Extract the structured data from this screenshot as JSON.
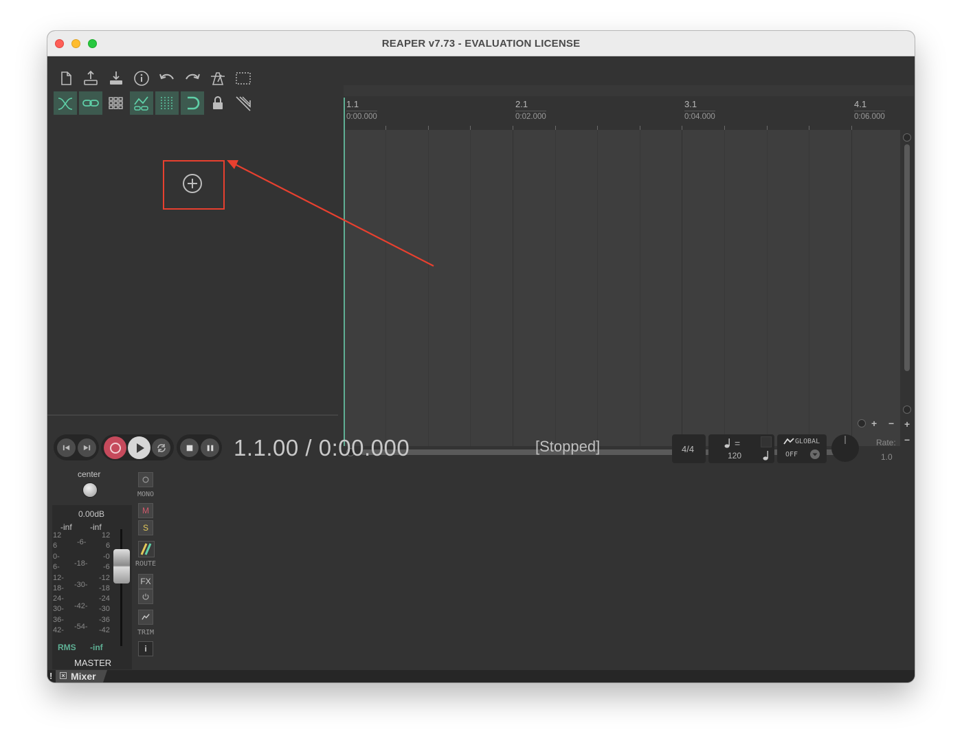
{
  "window": {
    "title": "REAPER v7.73 - EVALUATION LICENSE"
  },
  "toolbar": {
    "row1": [
      "new-project",
      "open-project",
      "save-project",
      "project-settings",
      "undo",
      "redo",
      "metronome",
      "grid-toggle"
    ],
    "row2": [
      "auto-crossfade",
      "link-items",
      "item-grouping",
      "envelope-points-follow",
      "snap-grid",
      "ripple-editing",
      "lock",
      "cursor-move"
    ]
  },
  "tracks": {
    "add_button_icon": "plus-circle-icon"
  },
  "ruler": {
    "marks": [
      {
        "bar": "1.1",
        "time": "0:00.000"
      },
      {
        "bar": "2.1",
        "time": "0:02.000"
      },
      {
        "bar": "3.1",
        "time": "0:04.000"
      },
      {
        "bar": "4.1",
        "time": "0:06.000"
      }
    ]
  },
  "transport": {
    "position": "1.1.00 / 0:00.000",
    "status": "[Stopped]",
    "time_signature": "4/4",
    "tempo_equals": "=",
    "tempo": "120",
    "global": "GLOBAL",
    "global_value": "OFF",
    "rate_label": "Rate:",
    "rate_value": "1.0"
  },
  "mixer": {
    "pan_label": "center",
    "volume": "0.00dB",
    "peak_left": "-inf",
    "peak_right": "-inf",
    "scale_left": [
      "12",
      "6",
      "0-",
      "6-",
      "12-",
      "18-",
      "24-",
      "30-",
      "36-",
      "42-"
    ],
    "scale_mid": [
      "-6-",
      "-18-",
      "-30-",
      "-42-",
      "-54-"
    ],
    "scale_right": [
      "12",
      "6",
      "-0",
      "-6",
      "-12",
      "-18",
      "-24",
      "-30",
      "-36",
      "-42"
    ],
    "rms_label": "RMS",
    "rms_value": "-inf",
    "track_name": "MASTER",
    "buttons": {
      "mono": "MONO",
      "mute": "M",
      "solo": "S",
      "route": "ROUTE",
      "fx": "FX",
      "trim": "TRIM",
      "info": "i"
    },
    "tab_label": "Mixer",
    "tab_prefix": "!"
  },
  "colors": {
    "accent": "#5fb095",
    "highlight": "#e8402f"
  }
}
